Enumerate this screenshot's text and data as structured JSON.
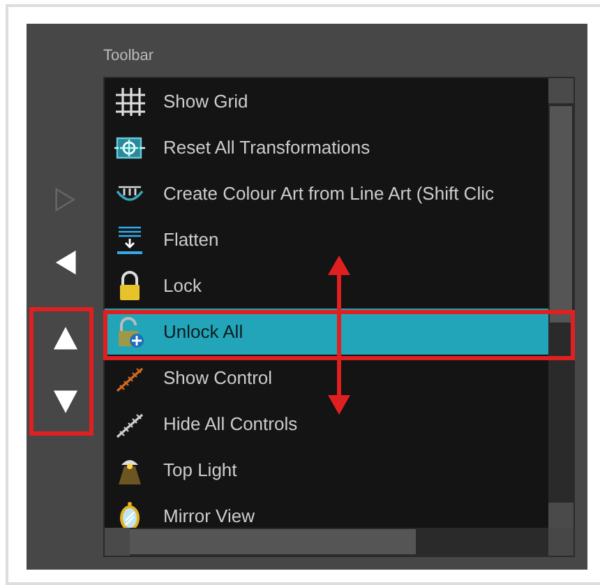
{
  "panel": {
    "label": "Toolbar",
    "move_buttons": [
      {
        "kind": "right",
        "disabled": true
      },
      {
        "kind": "left",
        "disabled": false
      },
      {
        "kind": "up",
        "disabled": false
      },
      {
        "kind": "down",
        "disabled": false
      }
    ],
    "items": [
      {
        "kind": "grid",
        "label": "Show Grid",
        "selected": false
      },
      {
        "kind": "reset",
        "label": "Reset All Transformations",
        "selected": false
      },
      {
        "kind": "colour-art",
        "label": "Create Colour Art from Line Art (Shift Clic",
        "selected": false
      },
      {
        "kind": "flatten",
        "label": "Flatten",
        "selected": false
      },
      {
        "kind": "lock",
        "label": "Lock",
        "selected": false
      },
      {
        "kind": "unlock",
        "label": "Unlock All",
        "selected": true
      },
      {
        "kind": "show-control",
        "label": "Show Control",
        "selected": false
      },
      {
        "kind": "hide-controls",
        "label": "Hide All Controls",
        "selected": false
      },
      {
        "kind": "light",
        "label": "Top Light",
        "selected": false
      },
      {
        "kind": "mirror",
        "label": "Mirror View",
        "selected": false
      }
    ]
  }
}
